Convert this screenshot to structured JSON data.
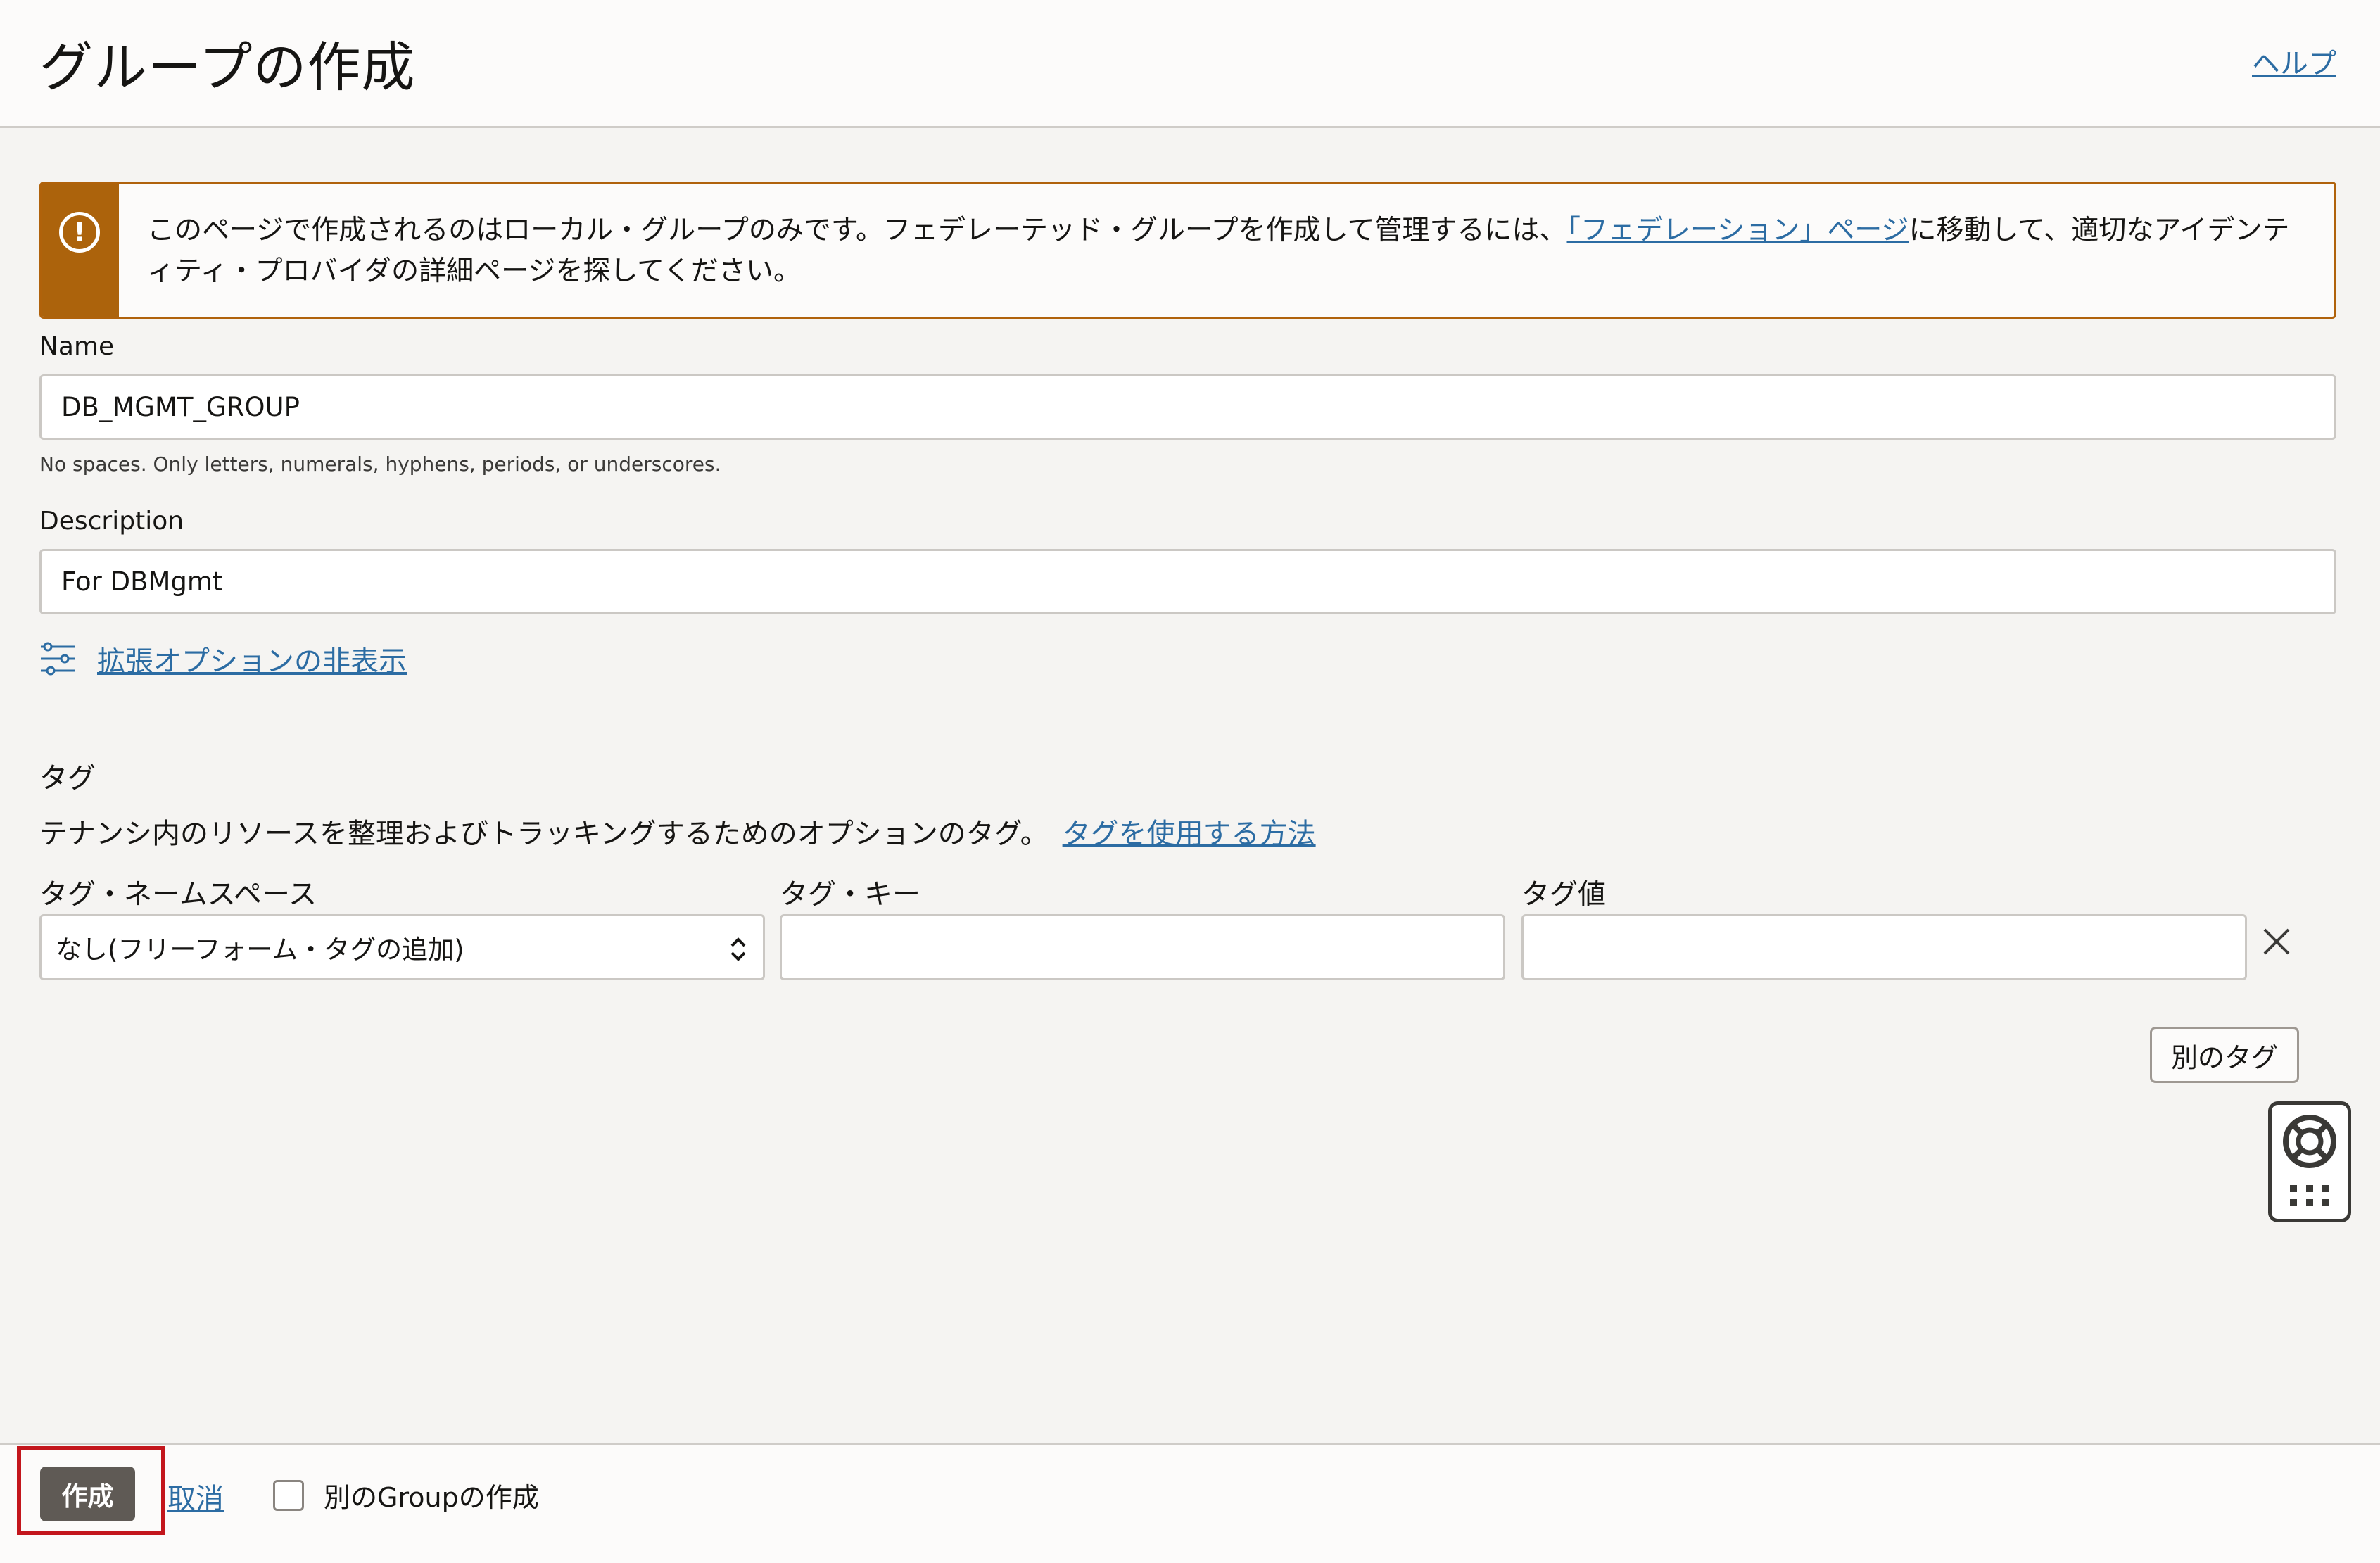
{
  "header": {
    "title": "グループの作成",
    "help_label": "ヘルプ"
  },
  "banner": {
    "text_before": "このページで作成されるのはローカル・グループのみです。フェデレーテッド・グループを作成して管理するには、",
    "link": "「フェデレーション」ページ",
    "text_after": "に移動して、適切なアイデンティティ・プロバイダの詳細ページを探してください。",
    "icon": "exclamation-circle-icon",
    "accent_color": "#ac630c"
  },
  "form": {
    "name_label": "Name",
    "name_value": "DB_MGMT_GROUP",
    "name_hint": "No spaces. Only letters, numerals, hyphens, periods, or underscores.",
    "description_label": "Description",
    "description_value": "For DBMgmt",
    "advanced_options_link": "拡張オプションの非表示",
    "advanced_options_icon": "sliders-icon"
  },
  "tags": {
    "section_title": "タグ",
    "description": "テナンシ内のリソースを整理およびトラッキングするためのオプションのタグ。",
    "how_to_link": "タグを使用する方法",
    "namespace_label": "タグ・ネームスペース",
    "namespace_value": "なし(フリーフォーム・タグの追加)",
    "key_label": "タグ・キー",
    "key_value": "",
    "value_label": "タグ値",
    "value_value": "",
    "remove_icon": "close-icon",
    "another_tag_label": "別のタグ"
  },
  "help_widget": {
    "icon": "lifebuoy-icon",
    "grid_icon": "grid-dots-icon"
  },
  "footer": {
    "create_label": "作成",
    "cancel_label": "取消",
    "create_another_label": "別のGroupの作成",
    "create_another_checked": false,
    "highlight_color": "#c3161c"
  }
}
